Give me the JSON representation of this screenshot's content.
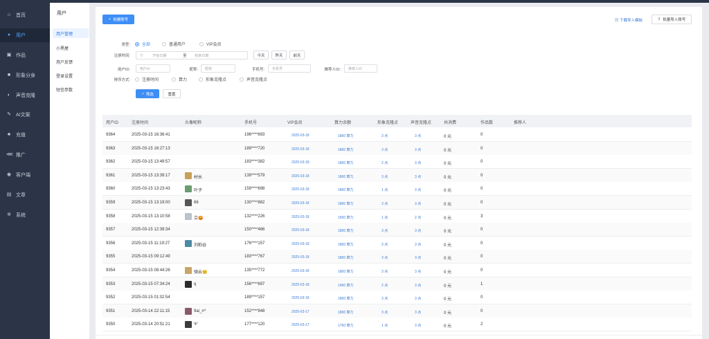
{
  "sidebar": {
    "items": [
      {
        "label": "首页",
        "icon": "home-icon",
        "glyph": "⌂"
      },
      {
        "label": "用户",
        "icon": "user-icon",
        "glyph": "●"
      },
      {
        "label": "作品",
        "icon": "works-icon",
        "glyph": "▣"
      },
      {
        "label": "形象分身",
        "icon": "avatar-clone-icon",
        "glyph": "■"
      },
      {
        "label": "声音克隆",
        "icon": "voice-clone-icon",
        "glyph": "◐"
      },
      {
        "label": "AI文案",
        "icon": "ai-copy-icon",
        "glyph": "✎"
      },
      {
        "label": "充值",
        "icon": "recharge-icon",
        "glyph": "♣"
      },
      {
        "label": "推广",
        "icon": "share-icon",
        "glyph": "⋘"
      },
      {
        "label": "客户端",
        "icon": "client-icon",
        "glyph": "◉"
      },
      {
        "label": "文章",
        "icon": "article-icon",
        "glyph": "▤"
      },
      {
        "label": "系统",
        "icon": "system-gear-icon",
        "glyph": "✲"
      }
    ]
  },
  "subnav": {
    "title": "用户",
    "items": [
      "用户管理",
      "小黑屋",
      "用户反馈",
      "登录设置",
      "短信参数"
    ]
  },
  "toolbar": {
    "create": "创建账号",
    "download_template": "下载导入模板",
    "batch_import": "批量导入账号"
  },
  "filters": {
    "type_label": "类型:",
    "type_options": [
      "全部",
      "普通用户",
      "VIP会员"
    ],
    "reg_label": "注册时间:",
    "date_start": "开始日期",
    "date_to": "至",
    "date_end": "结束日期",
    "quick_dates": [
      "今天",
      "昨天",
      "前天"
    ],
    "uid_label": "用户ID:",
    "uid_ph": "用户id",
    "nick_label": "昵称:",
    "nick_ph": "昵称",
    "phone_label": "手机号:",
    "phone_ph": "手机号",
    "ref_label": "推荐人ID:",
    "ref_ph": "推荐人ID",
    "sort_label": "排序方式:",
    "sort_options": [
      "注册时间",
      "算力",
      "形象克隆点",
      "声音克隆点"
    ],
    "filter_btn": "筛选",
    "reset_btn": "重置"
  },
  "table": {
    "columns": [
      "用户ID",
      "注册时间",
      "头像昵称",
      "手机号",
      "VIP会员",
      "算力余额",
      "形象克隆点",
      "声音克隆点",
      "共消费",
      "作品数",
      "推荐人"
    ],
    "rows": [
      {
        "id": "9364",
        "time": "2025-03-15 16:36:41",
        "nick": "",
        "avatar": "",
        "phone": "196****693",
        "vip": "2025-03-18",
        "power": "1800 算力",
        "img": "3 点",
        "voice": "3 点",
        "spend": "0 元",
        "works": "0"
      },
      {
        "id": "9363",
        "time": "2025-03-15 16:27:13",
        "nick": "",
        "avatar": "",
        "phone": "189****720",
        "vip": "2025-03-18",
        "power": "1800 算力",
        "img": "3 点",
        "voice": "3 点",
        "spend": "0 元",
        "works": "0"
      },
      {
        "id": "9362",
        "time": "2025-03-15 13:49:57",
        "nick": "",
        "avatar": "",
        "phone": "183****382",
        "vip": "2025-03-18",
        "power": "1800 算力",
        "img": "2 点",
        "voice": "3 点",
        "spend": "0 元",
        "works": "0"
      },
      {
        "id": "9361",
        "time": "2025-03-15 13:39:17",
        "nick": "村长",
        "avatar": "#c7a05a",
        "phone": "139****579",
        "vip": "2025-03-18",
        "power": "1800 算力",
        "img": "3 点",
        "voice": "3 点",
        "spend": "0 元",
        "works": "0"
      },
      {
        "id": "9360",
        "time": "2025-03-15 13:23:43",
        "nick": "叶子",
        "avatar": "#6b9c6f",
        "phone": "159****698",
        "vip": "2025-03-18",
        "power": "1800 算力",
        "img": "1 点",
        "voice": "3 点",
        "spend": "0 元",
        "works": "0"
      },
      {
        "id": "9359",
        "time": "2025-03-15 13:19:00",
        "nick": "66",
        "avatar": "#555555",
        "phone": "130****882",
        "vip": "2025-03-18",
        "power": "1800 算力",
        "img": "3 点",
        "voice": "3 点",
        "spend": "0 元",
        "works": "0"
      },
      {
        "id": "9358",
        "time": "2025-03-15 13:10:58",
        "nick": "立😡",
        "avatar": "#b9c3cc",
        "phone": "132****226",
        "vip": "2025-03-18",
        "power": "1500 算力",
        "img": "1 点",
        "voice": "2 点",
        "spend": "0 元",
        "works": "3"
      },
      {
        "id": "9357",
        "time": "2025-03-15 12:39:34",
        "nick": "",
        "avatar": "",
        "phone": "150****466",
        "vip": "2025-03-18",
        "power": "1800 算力",
        "img": "3 点",
        "voice": "3 点",
        "spend": "0 元",
        "works": "0"
      },
      {
        "id": "9356",
        "time": "2025-03-15 11:19:27",
        "nick": "刘柏谷",
        "avatar": "#4c8aa6",
        "phone": "176****157",
        "vip": "2025-03-18",
        "power": "1800 算力",
        "img": "3 点",
        "voice": "3 点",
        "spend": "0 元",
        "works": "0"
      },
      {
        "id": "9355",
        "time": "2025-03-15 09:12:49",
        "nick": "",
        "avatar": "",
        "phone": "183****767",
        "vip": "2025-03-18",
        "power": "1800 算力",
        "img": "3 点",
        "voice": "3 点",
        "spend": "0 元",
        "works": "0"
      },
      {
        "id": "9354",
        "time": "2025-03-15 08:44:26",
        "nick": "骑云😊",
        "avatar": "#c9a46b",
        "phone": "135****772",
        "vip": "2025-03-18",
        "power": "1800 算力",
        "img": "3 点",
        "voice": "3 点",
        "spend": "0 元",
        "works": "0"
      },
      {
        "id": "9353",
        "time": "2025-03-15 07:34:24",
        "nick": "q",
        "avatar": "#2b2b2b",
        "phone": "156****697",
        "vip": "2025-03-18",
        "power": "1460 算力",
        "img": "2 点",
        "voice": "3 点",
        "spend": "0 元",
        "works": "1"
      },
      {
        "id": "9352",
        "time": "2025-03-15 01:02:54",
        "nick": "",
        "avatar": "",
        "phone": "189****157",
        "vip": "2025-03-18",
        "power": "1800 算力",
        "img": "3 点",
        "voice": "3 点",
        "spend": "0 元",
        "works": "0"
      },
      {
        "id": "9351",
        "time": "2025-03-14 22:11:15",
        "nick": "9ai_n^",
        "avatar": "#8a5a6a",
        "phone": "152****948",
        "vip": "2025-03-17",
        "power": "1800 算力",
        "img": "3 点",
        "voice": "3 点",
        "spend": "0 元",
        "works": "0"
      },
      {
        "id": "9350",
        "time": "2025-03-14 20:51:21",
        "nick": "Ψ",
        "avatar": "#3c3c3c",
        "phone": "177****120",
        "vip": "2025-03-17",
        "power": "1760 算力",
        "img": "1 点",
        "voice": "3 点",
        "spend": "0 元",
        "works": "2"
      }
    ]
  },
  "colors": {
    "sidebar": "#2b3547",
    "primary": "#3d8ef5",
    "link": "#3a7bd5"
  }
}
